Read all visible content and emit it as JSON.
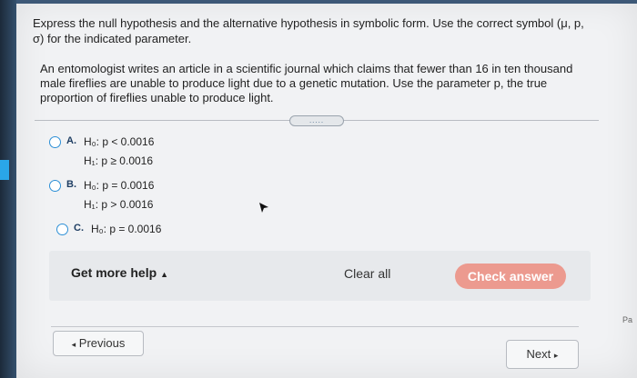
{
  "prompt": "Express the null hypothesis and the alternative hypothesis in symbolic form. Use the correct symbol (μ, p, σ) for the indicated parameter.",
  "problem": "An entomologist writes an article in a scientific journal which claims that fewer than 16 in ten thousand male fireflies are unable to produce light due to a genetic mutation. Use the parameter p, the true proportion of fireflies unable to produce light.",
  "expander_text": ".....",
  "options": [
    {
      "letter": "A.",
      "h0": "H₀: p < 0.0016",
      "h1": "H₁: p ≥ 0.0016"
    },
    {
      "letter": "B.",
      "h0": "H₀: p = 0.0016",
      "h1": "H₁: p > 0.0016"
    },
    {
      "letter": "C.",
      "h0": "H₀: p = 0.0016",
      "h1": ""
    }
  ],
  "footer": {
    "help_label": "Get more help",
    "clear_label": "Clear all",
    "check_label": "Check answer"
  },
  "nav": {
    "prev_label": "Previous",
    "next_label": "Next",
    "page_label": "Pa"
  },
  "colors": {
    "accent": "#2c8fd6",
    "check_button": "#ec9a8f"
  }
}
